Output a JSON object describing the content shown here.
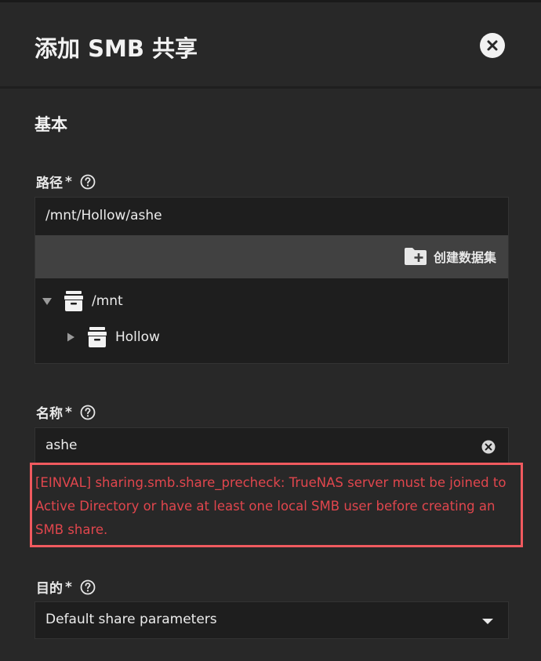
{
  "dialog": {
    "title": "添加 SMB 共享"
  },
  "section": {
    "title": "基本"
  },
  "path": {
    "label": "路径",
    "required": "*",
    "value": "/mnt/Hollow/ashe",
    "create_dataset_label": "创建数据集",
    "tree": [
      {
        "label": "/mnt",
        "expanded": true
      },
      {
        "label": "Hollow",
        "expanded": false
      }
    ]
  },
  "name": {
    "label": "名称",
    "required": "*",
    "value": "ashe"
  },
  "error": {
    "message": "[EINVAL] sharing.smb.share_precheck: TrueNAS server must be joined to Active Directory or have at least one local SMB user before creating an SMB share."
  },
  "purpose": {
    "label": "目的",
    "required": "*",
    "value": "Default share parameters"
  },
  "colors": {
    "background": "#282828",
    "input_background": "#1e1e1e",
    "toolbar_background": "#414141",
    "error": "#e0464d",
    "error_border": "#f05a5f"
  }
}
